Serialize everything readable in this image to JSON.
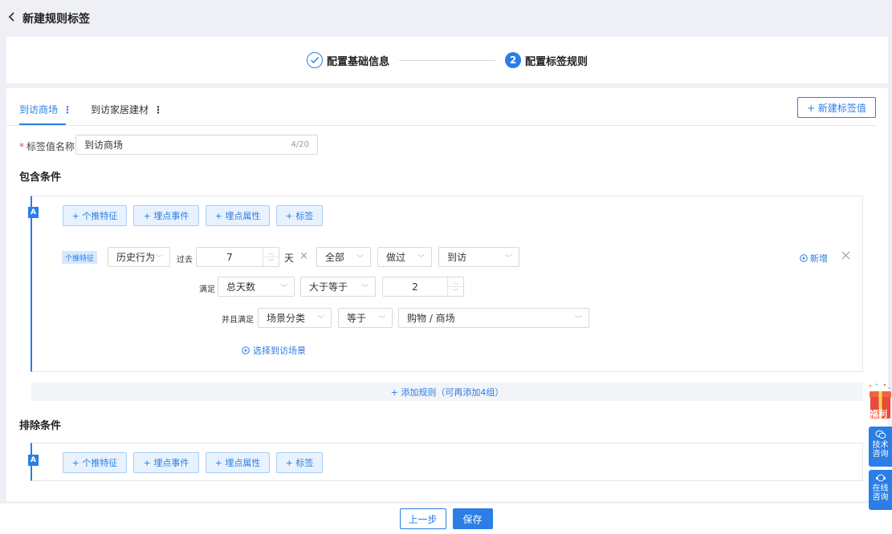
{
  "header": {
    "back_icon": "chevron-left-icon",
    "title": "新建规则标签"
  },
  "steps": [
    {
      "label": "配置基础信息",
      "state": "done",
      "icon": "check-icon"
    },
    {
      "label": "配置标签规则",
      "state": "active",
      "number": "2"
    }
  ],
  "tabs": [
    {
      "label": "到访商场",
      "active": true,
      "more": "⋮"
    },
    {
      "label": "到访家居建材",
      "active": false,
      "more": "⋮"
    }
  ],
  "new_tag_value_button": "+ 新建标签值",
  "tag_name": {
    "required_mark": "*",
    "label": "标签值名称:",
    "value": "到访商场",
    "counter": "4/20"
  },
  "include": {
    "title": "包含条件",
    "group_badge": "A",
    "add_buttons": [
      "+ 个推特征",
      "+ 埋点事件",
      "+ 埋点属性",
      "+ 标签"
    ],
    "rule": {
      "feature_chip": "个推特征",
      "behavior": "历史行为",
      "past_label": "过去",
      "days_value": "7",
      "days_unit": "天",
      "clear_icon": "×",
      "scope": "全部",
      "action": "做过",
      "event": "到访",
      "add_label": "新增",
      "add_icon": "plus-circle-icon",
      "remove_icon": "close-icon",
      "satisfy_label": "满足",
      "metric": "总天数",
      "comparator": "大于等于",
      "threshold": "2",
      "and_satisfy_label": "并且满足",
      "dimension": "场景分类",
      "dim_operator": "等于",
      "dim_value": "购物 / 商场",
      "select_scene_link": "选择到访场景"
    },
    "add_rule": "+ 添加规则（可再添加4组）"
  },
  "exclude": {
    "title": "排除条件",
    "group_badge": "A",
    "add_buttons": [
      "+ 个推特征",
      "+ 埋点事件",
      "+ 埋点属性",
      "+ 标签"
    ]
  },
  "footer": {
    "prev": "上一步",
    "save": "保存"
  },
  "widgets": {
    "gift_label": "福利",
    "tech": "技术咨询",
    "online": "在线咨询"
  },
  "colors": {
    "primary": "#2b7ee6",
    "background": "#eef0f5"
  }
}
